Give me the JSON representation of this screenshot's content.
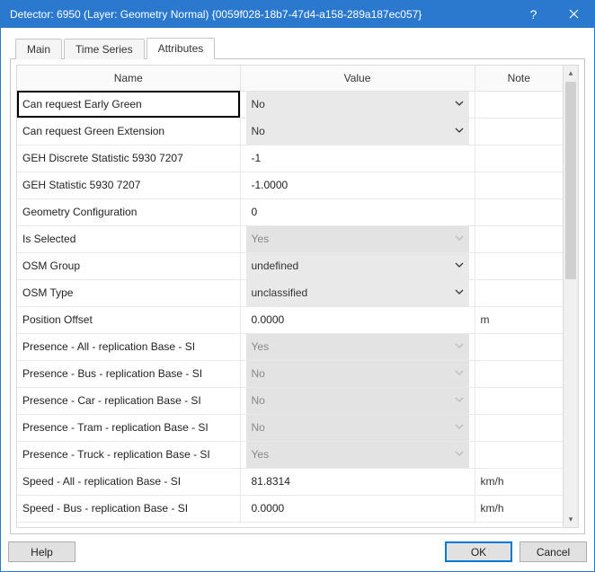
{
  "titlebar": {
    "title": "Detector: 6950 (Layer: Geometry Normal) {0059f028-18b7-47d4-a158-289a187ec057}"
  },
  "tabs": {
    "main": "Main",
    "timeseries": "Time Series",
    "attributes": "Attributes"
  },
  "columns": {
    "name": "Name",
    "value": "Value",
    "note": "Note"
  },
  "rows": [
    {
      "name": "Can request Early Green",
      "value": "No",
      "note": "",
      "type": "dd",
      "readonly": false,
      "selected": true
    },
    {
      "name": "Can request Green Extension",
      "value": "No",
      "note": "",
      "type": "dd",
      "readonly": false
    },
    {
      "name": "GEH Discrete Statistic 5930 7207",
      "value": "-1",
      "note": "",
      "type": "txt",
      "readonly": false
    },
    {
      "name": "GEH Statistic 5930 7207",
      "value": "-1.0000",
      "note": "",
      "type": "txt",
      "readonly": false
    },
    {
      "name": "Geometry Configuration",
      "value": "0",
      "note": "",
      "type": "txt",
      "readonly": false
    },
    {
      "name": "Is Selected",
      "value": "Yes",
      "note": "",
      "type": "dd",
      "readonly": true
    },
    {
      "name": "OSM Group",
      "value": "undefined",
      "note": "",
      "type": "dd",
      "readonly": false
    },
    {
      "name": "OSM Type",
      "value": "unclassified",
      "note": "",
      "type": "dd",
      "readonly": false
    },
    {
      "name": "Position Offset",
      "value": "0.0000",
      "note": "m",
      "type": "txt",
      "readonly": false
    },
    {
      "name": "Presence - All - replication Base - SI",
      "value": "Yes",
      "note": "",
      "type": "dd",
      "readonly": true
    },
    {
      "name": "Presence - Bus - replication Base - SI",
      "value": "No",
      "note": "",
      "type": "dd",
      "readonly": true
    },
    {
      "name": "Presence - Car - replication Base - SI",
      "value": "No",
      "note": "",
      "type": "dd",
      "readonly": true
    },
    {
      "name": "Presence - Tram - replication Base - SI",
      "value": "No",
      "note": "",
      "type": "dd",
      "readonly": true
    },
    {
      "name": "Presence - Truck - replication Base - SI",
      "value": "Yes",
      "note": "",
      "type": "dd",
      "readonly": true
    },
    {
      "name": "Speed - All - replication Base - SI",
      "value": "81.8314",
      "note": "km/h",
      "type": "txt",
      "readonly": false
    },
    {
      "name": "Speed - Bus - replication Base - SI",
      "value": "0.0000",
      "note": "km/h",
      "type": "txt",
      "readonly": false
    }
  ],
  "footer": {
    "help": "Help",
    "ok": "OK",
    "cancel": "Cancel"
  }
}
